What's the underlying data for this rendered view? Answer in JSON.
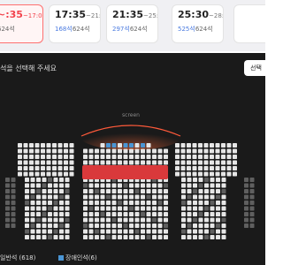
{
  "showtimes": [
    {
      "start": "~:35",
      "end": "~17:02",
      "remaining": "",
      "total": "624석",
      "selected": true
    },
    {
      "start": "17:35",
      "end": "~21:02",
      "remaining": "168석",
      "total": "624석",
      "selected": false
    },
    {
      "start": "21:35",
      "end": "~25:02",
      "remaining": "297석",
      "total": "624석",
      "selected": false
    },
    {
      "start": "25:30",
      "end": "~28:57",
      "remaining": "525석",
      "total": "624석",
      "selected": false
    }
  ],
  "hall": {
    "title": "석을 선택해 주세요",
    "select_button": "선택",
    "screen_label": "screen"
  },
  "legend": {
    "general": "일반석 (618)",
    "accessible": "장애인석(6)"
  },
  "colors": {
    "seat_available": "#e6e6e6",
    "seat_accessible": "#4a95d4",
    "seat_red_zone": "#d9393b",
    "seat_unavailable": "#5f5f5f",
    "background_dark": "#1a1a1a",
    "accent": "#f2434d"
  }
}
